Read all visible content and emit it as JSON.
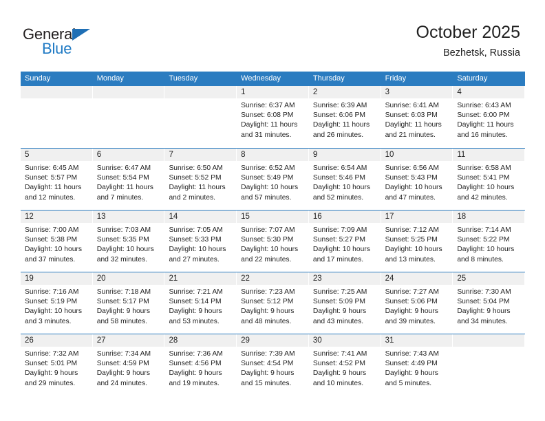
{
  "brand": {
    "name_top": "General",
    "name_bottom": "Blue",
    "accent_color": "#1f7ac4",
    "triangle_color": "#1f6fb5"
  },
  "header": {
    "title": "October 2025",
    "subtitle": "Bezhetsk, Russia"
  },
  "colors": {
    "header_row_bg": "#2b7cc0",
    "header_row_text": "#ffffff",
    "daynum_band_bg": "#f0f0f0",
    "row_separator": "#2b7cc0",
    "body_text": "#222222"
  },
  "weekdays": [
    "Sunday",
    "Monday",
    "Tuesday",
    "Wednesday",
    "Thursday",
    "Friday",
    "Saturday"
  ],
  "weeks": [
    [
      {
        "day": ""
      },
      {
        "day": ""
      },
      {
        "day": ""
      },
      {
        "day": "1",
        "sunrise": "Sunrise: 6:37 AM",
        "sunset": "Sunset: 6:08 PM",
        "daylight1": "Daylight: 11 hours",
        "daylight2": "and 31 minutes."
      },
      {
        "day": "2",
        "sunrise": "Sunrise: 6:39 AM",
        "sunset": "Sunset: 6:06 PM",
        "daylight1": "Daylight: 11 hours",
        "daylight2": "and 26 minutes."
      },
      {
        "day": "3",
        "sunrise": "Sunrise: 6:41 AM",
        "sunset": "Sunset: 6:03 PM",
        "daylight1": "Daylight: 11 hours",
        "daylight2": "and 21 minutes."
      },
      {
        "day": "4",
        "sunrise": "Sunrise: 6:43 AM",
        "sunset": "Sunset: 6:00 PM",
        "daylight1": "Daylight: 11 hours",
        "daylight2": "and 16 minutes."
      }
    ],
    [
      {
        "day": "5",
        "sunrise": "Sunrise: 6:45 AM",
        "sunset": "Sunset: 5:57 PM",
        "daylight1": "Daylight: 11 hours",
        "daylight2": "and 12 minutes."
      },
      {
        "day": "6",
        "sunrise": "Sunrise: 6:47 AM",
        "sunset": "Sunset: 5:54 PM",
        "daylight1": "Daylight: 11 hours",
        "daylight2": "and 7 minutes."
      },
      {
        "day": "7",
        "sunrise": "Sunrise: 6:50 AM",
        "sunset": "Sunset: 5:52 PM",
        "daylight1": "Daylight: 11 hours",
        "daylight2": "and 2 minutes."
      },
      {
        "day": "8",
        "sunrise": "Sunrise: 6:52 AM",
        "sunset": "Sunset: 5:49 PM",
        "daylight1": "Daylight: 10 hours",
        "daylight2": "and 57 minutes."
      },
      {
        "day": "9",
        "sunrise": "Sunrise: 6:54 AM",
        "sunset": "Sunset: 5:46 PM",
        "daylight1": "Daylight: 10 hours",
        "daylight2": "and 52 minutes."
      },
      {
        "day": "10",
        "sunrise": "Sunrise: 6:56 AM",
        "sunset": "Sunset: 5:43 PM",
        "daylight1": "Daylight: 10 hours",
        "daylight2": "and 47 minutes."
      },
      {
        "day": "11",
        "sunrise": "Sunrise: 6:58 AM",
        "sunset": "Sunset: 5:41 PM",
        "daylight1": "Daylight: 10 hours",
        "daylight2": "and 42 minutes."
      }
    ],
    [
      {
        "day": "12",
        "sunrise": "Sunrise: 7:00 AM",
        "sunset": "Sunset: 5:38 PM",
        "daylight1": "Daylight: 10 hours",
        "daylight2": "and 37 minutes."
      },
      {
        "day": "13",
        "sunrise": "Sunrise: 7:03 AM",
        "sunset": "Sunset: 5:35 PM",
        "daylight1": "Daylight: 10 hours",
        "daylight2": "and 32 minutes."
      },
      {
        "day": "14",
        "sunrise": "Sunrise: 7:05 AM",
        "sunset": "Sunset: 5:33 PM",
        "daylight1": "Daylight: 10 hours",
        "daylight2": "and 27 minutes."
      },
      {
        "day": "15",
        "sunrise": "Sunrise: 7:07 AM",
        "sunset": "Sunset: 5:30 PM",
        "daylight1": "Daylight: 10 hours",
        "daylight2": "and 22 minutes."
      },
      {
        "day": "16",
        "sunrise": "Sunrise: 7:09 AM",
        "sunset": "Sunset: 5:27 PM",
        "daylight1": "Daylight: 10 hours",
        "daylight2": "and 17 minutes."
      },
      {
        "day": "17",
        "sunrise": "Sunrise: 7:12 AM",
        "sunset": "Sunset: 5:25 PM",
        "daylight1": "Daylight: 10 hours",
        "daylight2": "and 13 minutes."
      },
      {
        "day": "18",
        "sunrise": "Sunrise: 7:14 AM",
        "sunset": "Sunset: 5:22 PM",
        "daylight1": "Daylight: 10 hours",
        "daylight2": "and 8 minutes."
      }
    ],
    [
      {
        "day": "19",
        "sunrise": "Sunrise: 7:16 AM",
        "sunset": "Sunset: 5:19 PM",
        "daylight1": "Daylight: 10 hours",
        "daylight2": "and 3 minutes."
      },
      {
        "day": "20",
        "sunrise": "Sunrise: 7:18 AM",
        "sunset": "Sunset: 5:17 PM",
        "daylight1": "Daylight: 9 hours",
        "daylight2": "and 58 minutes."
      },
      {
        "day": "21",
        "sunrise": "Sunrise: 7:21 AM",
        "sunset": "Sunset: 5:14 PM",
        "daylight1": "Daylight: 9 hours",
        "daylight2": "and 53 minutes."
      },
      {
        "day": "22",
        "sunrise": "Sunrise: 7:23 AM",
        "sunset": "Sunset: 5:12 PM",
        "daylight1": "Daylight: 9 hours",
        "daylight2": "and 48 minutes."
      },
      {
        "day": "23",
        "sunrise": "Sunrise: 7:25 AM",
        "sunset": "Sunset: 5:09 PM",
        "daylight1": "Daylight: 9 hours",
        "daylight2": "and 43 minutes."
      },
      {
        "day": "24",
        "sunrise": "Sunrise: 7:27 AM",
        "sunset": "Sunset: 5:06 PM",
        "daylight1": "Daylight: 9 hours",
        "daylight2": "and 39 minutes."
      },
      {
        "day": "25",
        "sunrise": "Sunrise: 7:30 AM",
        "sunset": "Sunset: 5:04 PM",
        "daylight1": "Daylight: 9 hours",
        "daylight2": "and 34 minutes."
      }
    ],
    [
      {
        "day": "26",
        "sunrise": "Sunrise: 7:32 AM",
        "sunset": "Sunset: 5:01 PM",
        "daylight1": "Daylight: 9 hours",
        "daylight2": "and 29 minutes."
      },
      {
        "day": "27",
        "sunrise": "Sunrise: 7:34 AM",
        "sunset": "Sunset: 4:59 PM",
        "daylight1": "Daylight: 9 hours",
        "daylight2": "and 24 minutes."
      },
      {
        "day": "28",
        "sunrise": "Sunrise: 7:36 AM",
        "sunset": "Sunset: 4:56 PM",
        "daylight1": "Daylight: 9 hours",
        "daylight2": "and 19 minutes."
      },
      {
        "day": "29",
        "sunrise": "Sunrise: 7:39 AM",
        "sunset": "Sunset: 4:54 PM",
        "daylight1": "Daylight: 9 hours",
        "daylight2": "and 15 minutes."
      },
      {
        "day": "30",
        "sunrise": "Sunrise: 7:41 AM",
        "sunset": "Sunset: 4:52 PM",
        "daylight1": "Daylight: 9 hours",
        "daylight2": "and 10 minutes."
      },
      {
        "day": "31",
        "sunrise": "Sunrise: 7:43 AM",
        "sunset": "Sunset: 4:49 PM",
        "daylight1": "Daylight: 9 hours",
        "daylight2": "and 5 minutes."
      },
      {
        "day": ""
      }
    ]
  ]
}
